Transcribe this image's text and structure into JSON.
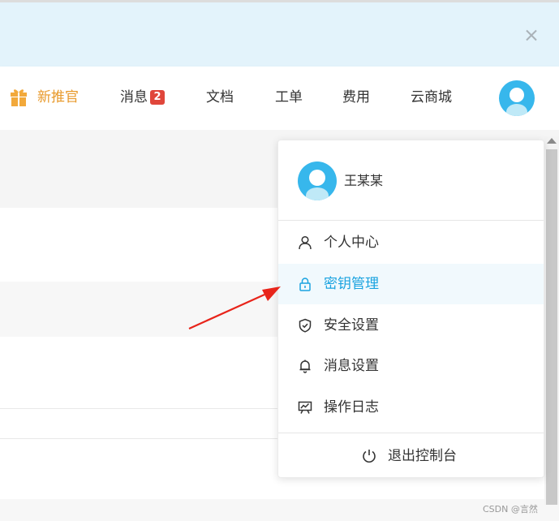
{
  "nav": {
    "promo_label": "新推官",
    "messages_label": "消息",
    "messages_badge": "2",
    "docs_label": "文档",
    "tickets_label": "工单",
    "billing_label": "费用",
    "store_label": "云商城"
  },
  "dropdown": {
    "user_name": "王某某",
    "items": [
      {
        "label": "个人中心",
        "icon": "user-icon"
      },
      {
        "label": "密钥管理",
        "icon": "lock-icon",
        "active": true
      },
      {
        "label": "安全设置",
        "icon": "shield-check-icon"
      },
      {
        "label": "消息设置",
        "icon": "bell-icon"
      },
      {
        "label": "操作日志",
        "icon": "chart-presentation-icon"
      }
    ],
    "logout_label": "退出控制台"
  },
  "colors": {
    "accent": "#1aa3e0",
    "promo": "#e89a2c",
    "badge": "#e0463b",
    "banner": "#e3f3fb",
    "avatar": "#37b7ec",
    "arrow": "#e8241a"
  },
  "watermark": "CSDN @言然"
}
